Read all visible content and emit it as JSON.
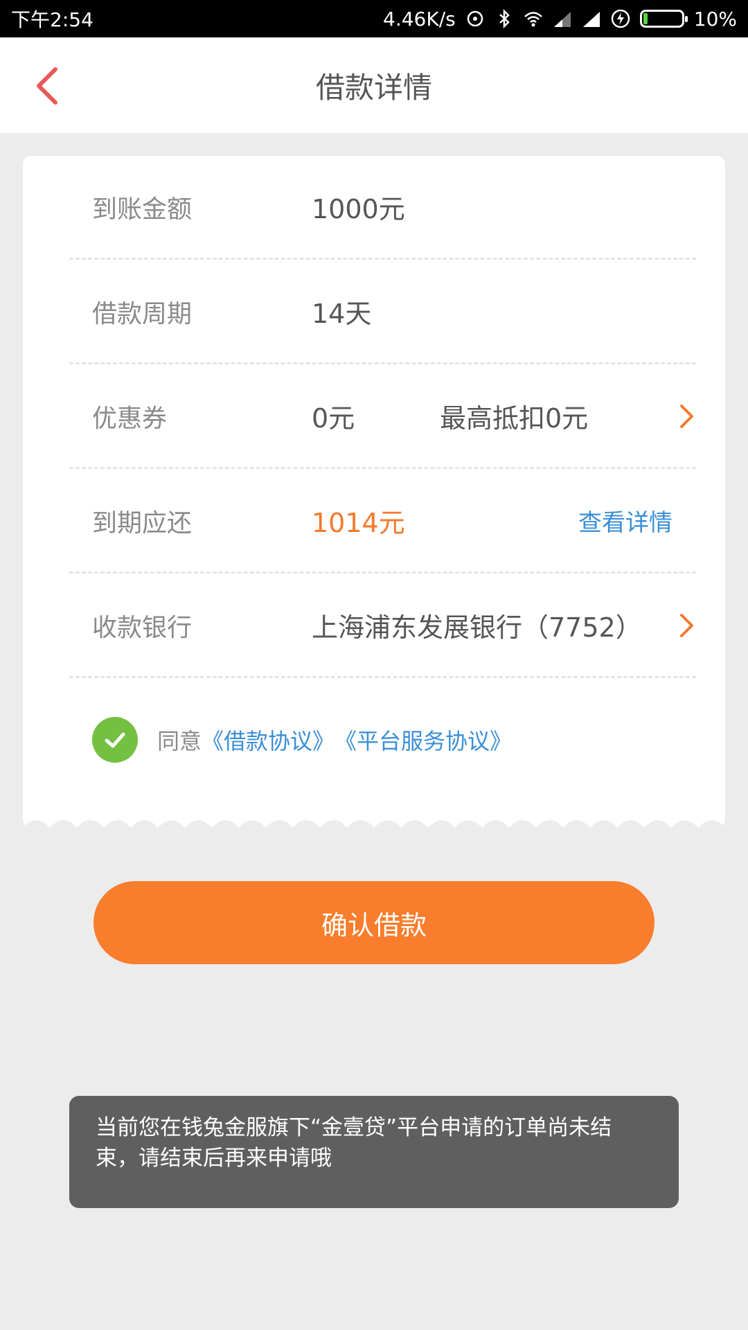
{
  "status_bar": {
    "time": "下午2:54",
    "speed": "4.46K/s",
    "battery": "10%"
  },
  "header": {
    "title": "借款详情"
  },
  "details": {
    "received_amount": {
      "label": "到账金额",
      "value": "1000元"
    },
    "loan_period": {
      "label": "借款周期",
      "value": "14天"
    },
    "coupon": {
      "label": "优惠券",
      "value": "0元",
      "extra": "最高抵扣0元"
    },
    "due_amount": {
      "label": "到期应还",
      "value": "1014元",
      "link": "查看详情"
    },
    "bank": {
      "label": "收款银行",
      "value": "上海浦东发展银行（7752）"
    }
  },
  "agreement": {
    "prefix": "同意",
    "loan_agreement": "《借款协议》",
    "service_agreement": "《平台服务协议》",
    "checked": true
  },
  "confirm_button": "确认借款",
  "toast": "当前您在钱兔金服旗下“金壹贷”平台申请的订单尚未结束，请结束后再来申请哦",
  "colors": {
    "accent": "#f87d2c",
    "link": "#3a8fd8",
    "check": "#74c043",
    "back": "#e85a5a"
  }
}
